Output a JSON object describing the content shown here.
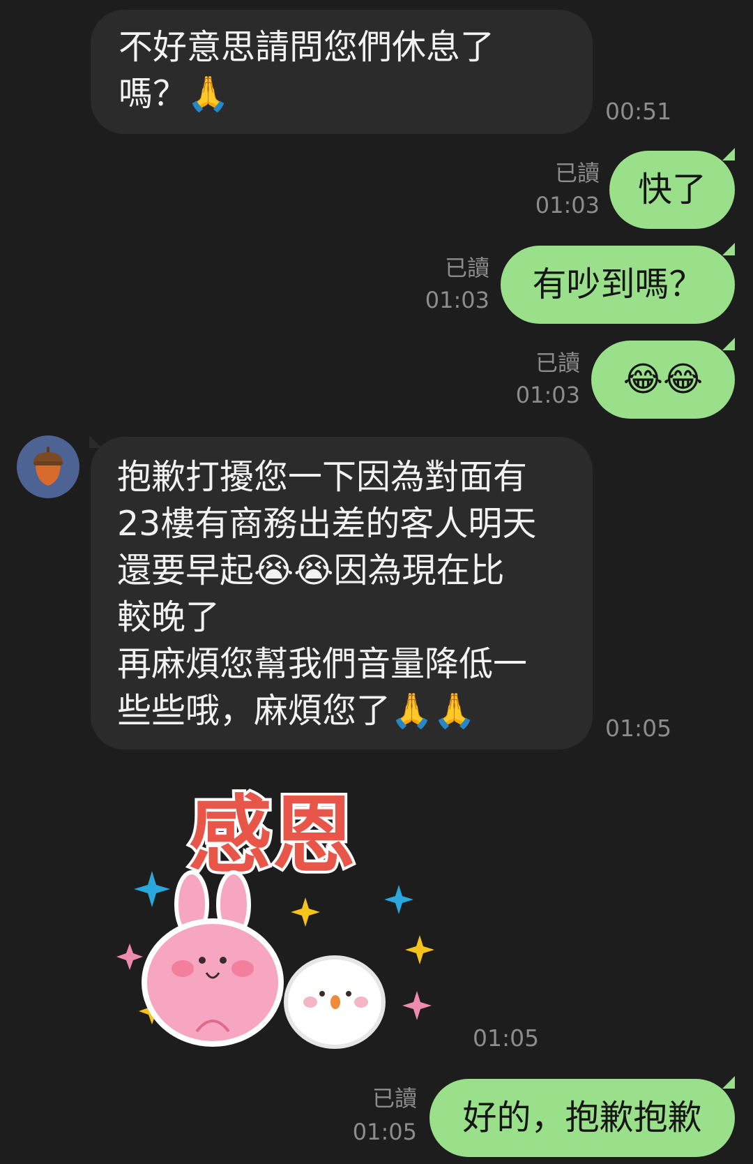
{
  "messages": [
    {
      "id": "m1",
      "side": "in",
      "text": "不好意思請問您們休息了\n嗎？🙏",
      "time": "00:51"
    },
    {
      "id": "m2",
      "side": "out",
      "text": "快了",
      "read": "已讀",
      "time": "01:03"
    },
    {
      "id": "m3",
      "side": "out",
      "text": "有吵到嗎？",
      "read": "已讀",
      "time": "01:03"
    },
    {
      "id": "m4",
      "side": "out",
      "text": "😂😂",
      "read": "已讀",
      "time": "01:03"
    },
    {
      "id": "m5",
      "side": "in",
      "text": "抱歉打擾您一下因為對面有\n23樓有商務出差的客人明天\n還要早起😭😭因為現在比\n較晚了\n再麻煩您幫我們音量降低一\n些些哦，麻煩您了🙏🙏",
      "time": "01:05"
    },
    {
      "id": "m6",
      "side": "in",
      "type": "sticker",
      "sticker_text": "感恩",
      "time": "01:05"
    },
    {
      "id": "m7",
      "side": "out",
      "text": "好的，抱歉抱歉",
      "read": "已讀",
      "time": "01:05"
    }
  ],
  "colors": {
    "background": "#1d1d1d",
    "incoming_bubble": "#2b2b2b",
    "outgoing_bubble": "#9adf89",
    "meta_text": "#8d8d8d",
    "avatar_bg": "#4c6394"
  },
  "icons": {
    "avatar": "acorn-icon"
  }
}
